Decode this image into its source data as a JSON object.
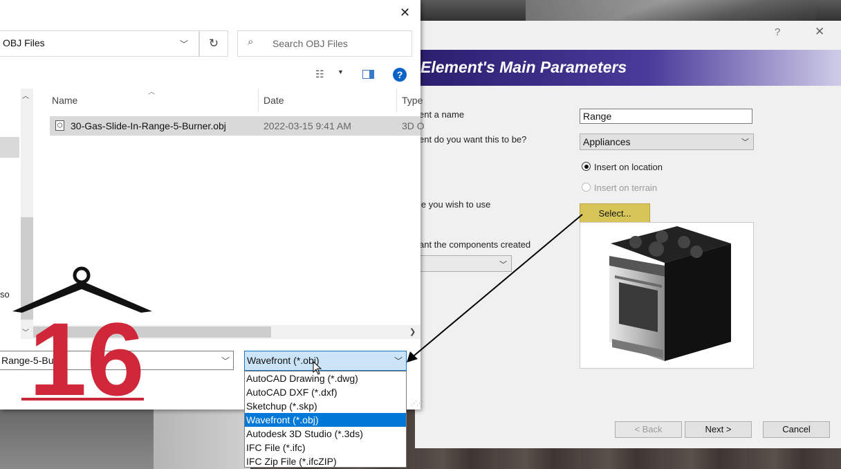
{
  "file_dialog": {
    "close_glyph": "✕",
    "path": "OBJ Files",
    "search_placeholder": "Search OBJ Files",
    "help_glyph": "?",
    "nav_partial_text": "so",
    "columns": {
      "name": "Name",
      "date": "Date",
      "type": "Type"
    },
    "files": [
      {
        "name": "30-Gas-Slide-In-Range-5-Burner.obj",
        "date": "2022-03-15 9:41 AM",
        "type": "3D O"
      }
    ],
    "filename_value": "Range-5-Burne",
    "file_type_selected": "Wavefront (*.obj)",
    "file_type_options": [
      "AutoCAD Drawing (*.dwg)",
      "AutoCAD DXF (*.dxf)",
      "Sketchup (*.skp)",
      "Wavefront (*.obj)",
      "Autodesk 3D Studio (*.3ds)",
      "IFC File (*.ifc)",
      "IFC Zip File (*.ifcZIP)"
    ],
    "highlighted_option_index": 3
  },
  "wizard": {
    "help_glyph": "?",
    "close_glyph": "✕",
    "banner_title": "Element's Main Parameters",
    "label_name": "ent a name",
    "label_category": "ent do you want this to be?",
    "label_file": "le you wish to use",
    "label_components": "ant the components created",
    "name_value": "Range",
    "category_value": "Appliances",
    "radio_location": "Insert on location",
    "radio_terrain": "Insert on terrain",
    "select_button": "Select...",
    "back_button": "< Back",
    "next_button": "Next >",
    "cancel_button": "Cancel"
  },
  "watermark": {
    "number": "16"
  },
  "colors": {
    "banner_dark": "#2a1e6e",
    "select_button": "#d8c55a",
    "highlight": "#0078d7",
    "logo_red": "#d0283a"
  }
}
